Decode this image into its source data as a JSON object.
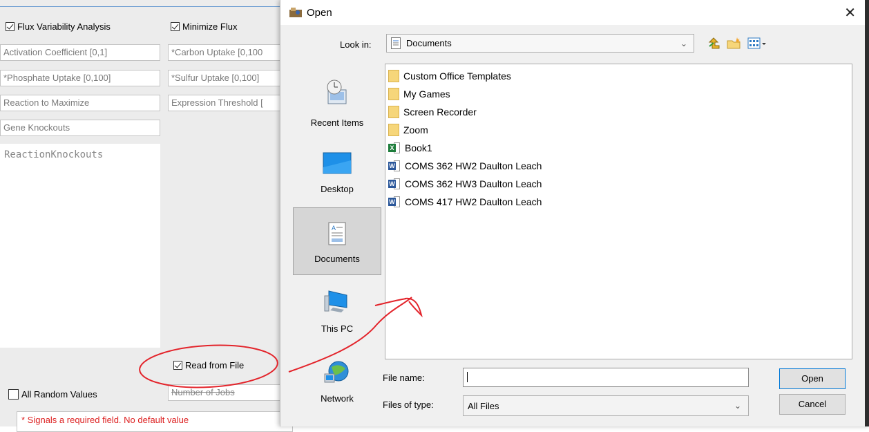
{
  "app": {
    "checkbox_fva": {
      "label": "Flux Variability Analysis",
      "checked": true
    },
    "checkbox_minimize": {
      "label": "Minimize Flux",
      "checked": true
    },
    "fields": {
      "activation": "Activation Coefficient [0,1]",
      "carbon": "*Carbon Uptake [0,100",
      "phosphate": "*Phosphate Uptake [0,100]",
      "sulfur": "*Sulfur Uptake [0,100]",
      "reaction_max": "Reaction to Maximize",
      "expression": "Expression Threshold [",
      "gene_knockouts": "Gene Knockouts",
      "number_of_jobs": "Number of Jobs"
    },
    "reaction_knockouts": "ReactionKnockouts",
    "checkbox_read_file": {
      "label": "Read from File",
      "checked": true
    },
    "checkbox_random": {
      "label": "All Random Values",
      "checked": false
    },
    "required_note": "* Signals a required field. No default value"
  },
  "dialog": {
    "title": "Open",
    "close_glyph": "✕",
    "look_in_label": "Look in:",
    "look_in_value": "Documents",
    "places": [
      {
        "label": "Recent Items",
        "icon": "recent-items-icon"
      },
      {
        "label": "Desktop",
        "icon": "desktop-icon"
      },
      {
        "label": "Documents",
        "icon": "documents-icon",
        "active": true
      },
      {
        "label": "This PC",
        "icon": "this-pc-icon"
      },
      {
        "label": "Network",
        "icon": "network-icon"
      }
    ],
    "files": [
      {
        "name": "Custom Office Templates",
        "type": "folder"
      },
      {
        "name": "My Games",
        "type": "folder"
      },
      {
        "name": "Screen Recorder",
        "type": "folder"
      },
      {
        "name": "Zoom",
        "type": "folder"
      },
      {
        "name": "Book1",
        "type": "excel"
      },
      {
        "name": "COMS 362 HW2 Daulton Leach",
        "type": "word"
      },
      {
        "name": "COMS 362 HW3 Daulton Leach",
        "type": "word"
      },
      {
        "name": "COMS 417 HW2 Daulton Leach",
        "type": "word"
      }
    ],
    "file_name_label": "File name:",
    "file_name_value": "",
    "files_of_type_label": "Files of type:",
    "files_of_type_value": "All Files",
    "open_button": "Open",
    "cancel_button": "Cancel"
  },
  "colors": {
    "annotation_red": "#e3242b",
    "accent_blue": "#0078d7"
  }
}
